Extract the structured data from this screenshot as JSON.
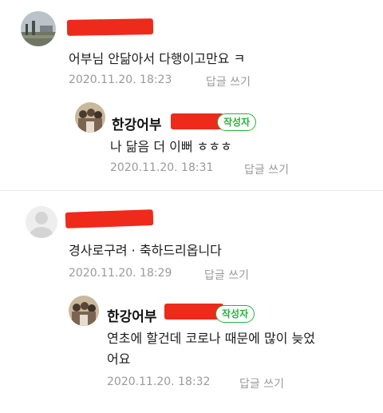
{
  "comments": [
    {
      "text": "어부님 안닮아서 다행이고만요 ㅋ",
      "time": "2020.11.20. 18:23",
      "reply_label": "답글 쓰기",
      "avatar_icon": "landscape-avatar",
      "reply": {
        "author": "한강어부",
        "badge": "작성자",
        "text": "나 닮음 더 이뻐 ㅎㅎㅎ",
        "time": "2020.11.20. 18:31",
        "reply_label": "답글 쓰기",
        "avatar_icon": "family-photo-avatar"
      }
    },
    {
      "text": "경사로구려 · 축하드리옵니다",
      "time": "2020.11.20. 18:29",
      "reply_label": "답글 쓰기",
      "avatar_icon": "default-user-avatar",
      "reply": {
        "author": "한강어부",
        "badge": "작성자",
        "text_line1": "연초에 할건데 코로나 때문에 많이 늦었",
        "text_line2": "어요",
        "time": "2020.11.20. 18:32",
        "reply_label": "답글 쓰기",
        "avatar_icon": "family-photo-avatar"
      }
    }
  ],
  "colors": {
    "badge_green": "#25b33a",
    "redaction_red": "#ee2a1b",
    "meta_gray": "#9a9a9a"
  }
}
